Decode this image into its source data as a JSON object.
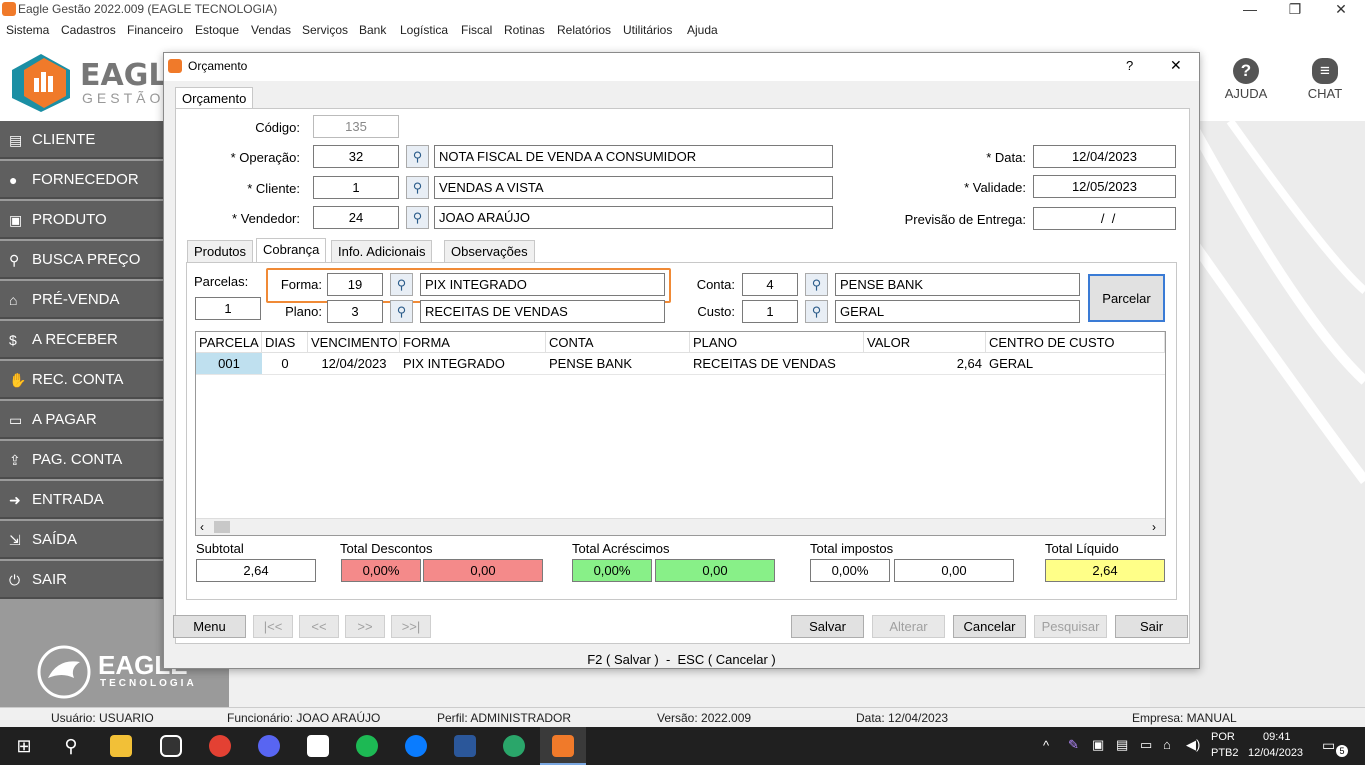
{
  "window": {
    "title": "Eagle Gestão 2022.009 (EAGLE TECNOLOGIA)"
  },
  "menu": [
    "Sistema",
    "Cadastros",
    "Financeiro",
    "Estoque",
    "Vendas",
    "Serviços",
    "Bank",
    "Logística",
    "Fiscal",
    "Rotinas",
    "Relatórios",
    "Utilitários",
    "Ajuda"
  ],
  "logo": {
    "name": "EAGLE",
    "sub": "GESTÃO",
    "bottom_name": "EAGLE",
    "bottom_sub": "TECNOLOGIA"
  },
  "help": {
    "ajuda": "AJUDA",
    "chat": "CHAT"
  },
  "sidebar": [
    {
      "label": "CLIENTE",
      "icon": "id-card-icon"
    },
    {
      "label": "FORNECEDOR",
      "icon": "users-icon"
    },
    {
      "label": "PRODUTO",
      "icon": "box-icon"
    },
    {
      "label": "BUSCA PREÇO",
      "icon": "search-icon"
    },
    {
      "label": "PRÉ-VENDA",
      "icon": "store-icon"
    },
    {
      "label": "A RECEBER",
      "icon": "dollar-icon"
    },
    {
      "label": "REC. CONTA",
      "icon": "hand-money-icon"
    },
    {
      "label": "A PAGAR",
      "icon": "wallet-icon"
    },
    {
      "label": "PAG. CONTA",
      "icon": "upload-icon"
    },
    {
      "label": "ENTRADA",
      "icon": "sign-in-icon"
    },
    {
      "label": "SAÍDA",
      "icon": "sign-out-icon"
    },
    {
      "label": "SAIR",
      "icon": "power-icon"
    }
  ],
  "dialog": {
    "title": "Orçamento",
    "help": "?",
    "close": "✕",
    "main_tab": "Orçamento",
    "codigo_label": "Código:",
    "codigo": "135",
    "operacao_label": "* Operação:",
    "operacao_code": "32",
    "operacao_desc": "NOTA FISCAL DE VENDA A CONSUMIDOR",
    "cliente_label": "* Cliente:",
    "cliente_code": "1",
    "cliente_desc": "VENDAS A VISTA",
    "vendedor_label": "* Vendedor:",
    "vendedor_code": "24",
    "vendedor_desc": "JOAO ARAÚJO",
    "data_label": "* Data:",
    "data": "12/04/2023",
    "validade_label": "* Validade:",
    "validade": "12/05/2023",
    "previsao_label": "Previsão de Entrega:",
    "previsao": "  /  /",
    "tabs": [
      "Produtos",
      "Cobrança",
      "Info. Adicionais",
      "Observações"
    ],
    "parcelas_label": "Parcelas:",
    "parcelas": "1",
    "forma_label": "Forma:",
    "forma_code": "19",
    "forma_desc": "PIX INTEGRADO",
    "plano_label": "Plano:",
    "plano_code": "3",
    "plano_desc": "RECEITAS DE VENDAS",
    "conta_label": "Conta:",
    "conta_code": "4",
    "conta_desc": "PENSE BANK",
    "custo_label": "Custo:",
    "custo_code": "1",
    "custo_desc": "GERAL",
    "parcelar_button": "Parcelar",
    "grid_headers": [
      "PARCELA",
      "DIAS",
      "VENCIMENTO",
      "FORMA",
      "CONTA",
      "PLANO",
      "VALOR",
      "CENTRO DE CUSTO"
    ],
    "grid_rows": [
      [
        "001",
        "0",
        "12/04/2023",
        "PIX INTEGRADO",
        "PENSE BANK",
        "RECEITAS DE VENDAS",
        "2,64",
        "GERAL"
      ]
    ],
    "totals": {
      "subtotal_label": "Subtotal",
      "subtotal": "2,64",
      "descontos_label": "Total Descontos",
      "descontos_pct": "0,00%",
      "descontos_val": "0,00",
      "acrescimos_label": "Total Acréscimos",
      "acrescimos_pct": "0,00%",
      "acrescimos_val": "0,00",
      "impostos_label": "Total impostos",
      "impostos_pct": "0,00%",
      "impostos_val": "0,00",
      "liquido_label": "Total Líquido",
      "liquido": "2,64"
    },
    "buttons": {
      "menu": "Menu",
      "first": "|<<",
      "prev": "<<",
      "next": ">>",
      "last": ">>|",
      "salvar": "Salvar",
      "alterar": "Alterar",
      "cancelar": "Cancelar",
      "pesquisar": "Pesquisar",
      "sair": "Sair"
    },
    "footer_keys": "F2 ( Salvar )  -  ESC ( Cancelar )"
  },
  "status": {
    "usuario": "Usuário: USUARIO",
    "funcionario": "Funcionário: JOAO ARAÚJO",
    "perfil": "Perfil: ADMINISTRADOR",
    "versao": "Versão: 2022.009",
    "data": "Data: 12/04/2023",
    "empresa": "Empresa: MANUAL"
  },
  "taskbar": {
    "lang1": "POR",
    "lang2": "PTB2",
    "time": "09:41",
    "date": "12/04/2023",
    "notif": "5"
  },
  "colors": {
    "sidebar_item": "#5f5f5f",
    "accent_orange": "#f08a36",
    "discount_red": "#f48a8a",
    "increase_green": "#88f088",
    "net_yellow": "#ffff88",
    "selected_cell": "#bfe0ef"
  }
}
